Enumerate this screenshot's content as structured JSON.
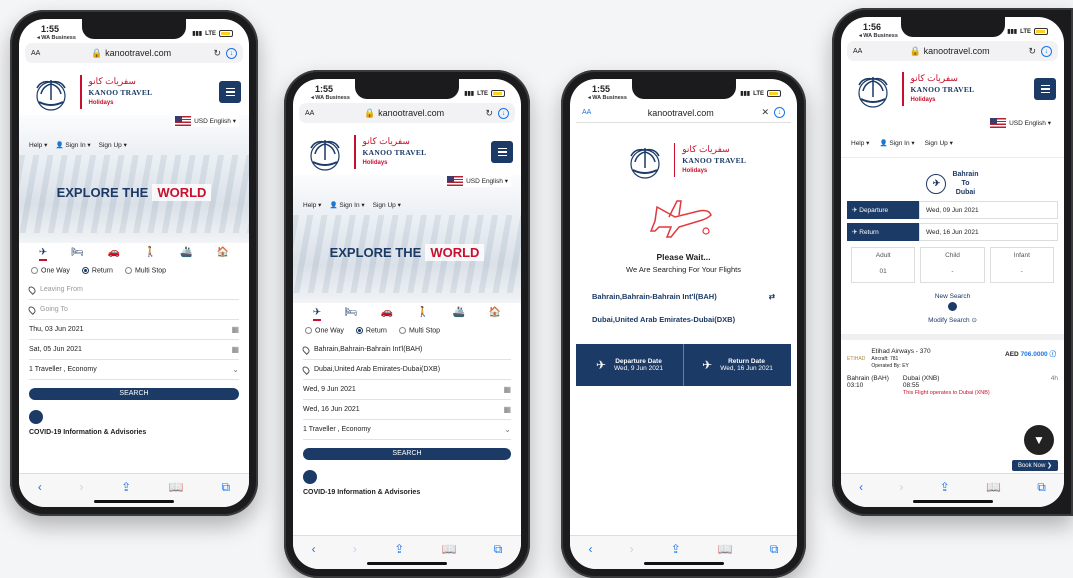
{
  "colors": {
    "brand_navy": "#1b3a66",
    "brand_red": "#c8102e",
    "ios_blue": "#1a74e8"
  },
  "phones": [
    {
      "status": {
        "time": "1:55",
        "back": "◂ WA Business",
        "carrier": "LTE"
      },
      "browser": {
        "aa": "AA",
        "url": "kanootravel.com"
      },
      "logo": {
        "arabic": "سفريات كانو",
        "english": "KANOO TRAVEL",
        "sub": "Holidays"
      },
      "currency": "USD English ▾",
      "nav": {
        "help": "Help ▾",
        "sign_in": "Sign In ▾",
        "sign_up": "Sign Up ▾"
      },
      "hero": {
        "explore": "EXPLORE THE",
        "world": "WORLD"
      },
      "trip_types": [
        "One Way",
        "Return",
        "Multi Stop"
      ],
      "fields": {
        "from": "Leaving From",
        "to": "Going To",
        "depart": "Thu, 03 Jun 2021",
        "return": "Sat, 05 Jun 2021",
        "travellers": "1 Traveller , Economy"
      },
      "search": "SEARCH",
      "covid": "COVID-19 Information & Advisories"
    },
    {
      "status": {
        "time": "1:55",
        "back": "◂ WA Business",
        "carrier": "LTE"
      },
      "browser": {
        "aa": "AA",
        "url": "kanootravel.com"
      },
      "logo": {
        "arabic": "سفريات كانو",
        "english": "KANOO TRAVEL",
        "sub": "Holidays"
      },
      "currency": "USD English ▾",
      "nav": {
        "help": "Help ▾",
        "sign_in": "Sign In ▾",
        "sign_up": "Sign Up ▾"
      },
      "hero": {
        "explore": "EXPLORE THE",
        "world": "WORLD"
      },
      "trip_types": [
        "One Way",
        "Return",
        "Multi Stop"
      ],
      "fields": {
        "from": "Bahrain,Bahrain-Bahrain Int'l(BAH)",
        "to": "Dubai,United Arab Emirates-Dubai(DXB)",
        "depart": "Wed, 9 Jun 2021",
        "return": "Wed, 16 Jun 2021",
        "travellers": "1 Traveller , Economy"
      },
      "search": "SEARCH",
      "covid": "COVID-19 Information & Advisories"
    }
  ],
  "waiting": {
    "status": {
      "time": "1:55",
      "back": "◂ WA Business",
      "carrier": "LTE"
    },
    "browser": {
      "aa": "AA",
      "url": "kanootravel.com",
      "close": "✕"
    },
    "logo": {
      "arabic": "سفريات كانو",
      "english": "KANOO TRAVEL",
      "sub": "Holidays"
    },
    "title": "Please Wait...",
    "subtitle": "We Are Searching For Your Flights",
    "from": "Bahrain,Bahrain-Bahrain Int'l(BAH)",
    "to": "Dubai,United Arab Emirates-Dubai(DXB)",
    "departure_label": "Departure Date",
    "departure_value": "Wed, 9 Jun 2021",
    "return_label": "Return Date",
    "return_value": "Wed, 16 Jun 2021"
  },
  "results": {
    "status": {
      "time": "1:56",
      "back": "◂ WA Business",
      "carrier": "LTE"
    },
    "browser": {
      "aa": "AA",
      "url": "kanootravel.com"
    },
    "logo": {
      "arabic": "سفريات كانو",
      "english": "KANOO TRAVEL",
      "sub": "Holidays"
    },
    "currency": "USD English ▾",
    "nav": {
      "help": "Help ▾",
      "sign_in": "Sign In ▾",
      "sign_up": "Sign Up ▾"
    },
    "route": {
      "from": "Bahrain",
      "to_word": "To",
      "to": "Dubai"
    },
    "departure_label": "✈ Departure",
    "departure_value": "Wed, 09 Jun 2021",
    "return_label": "✈ Return",
    "return_value": "Wed, 16 Jun 2021",
    "pax": [
      {
        "label": "Adult",
        "value": "01"
      },
      {
        "label": "Child",
        "value": "-"
      },
      {
        "label": "Infant",
        "value": "-"
      }
    ],
    "new_search": "New Search",
    "modify_search": "Modify Search",
    "flight": {
      "airline": "Etihad Airways - 370",
      "aircraft": "Aircraft: 781",
      "operated": "Operated By: EY",
      "currency": "AED",
      "price": "706.0000",
      "from_city": "Bahrain (BAH)",
      "from_time": "03:10",
      "to_city": "Dubai (XNB)",
      "to_time": "08:55",
      "note": "This Flight operates to Dubai (XNB)",
      "duration": "4h",
      "book": "Book Now ❯"
    }
  }
}
